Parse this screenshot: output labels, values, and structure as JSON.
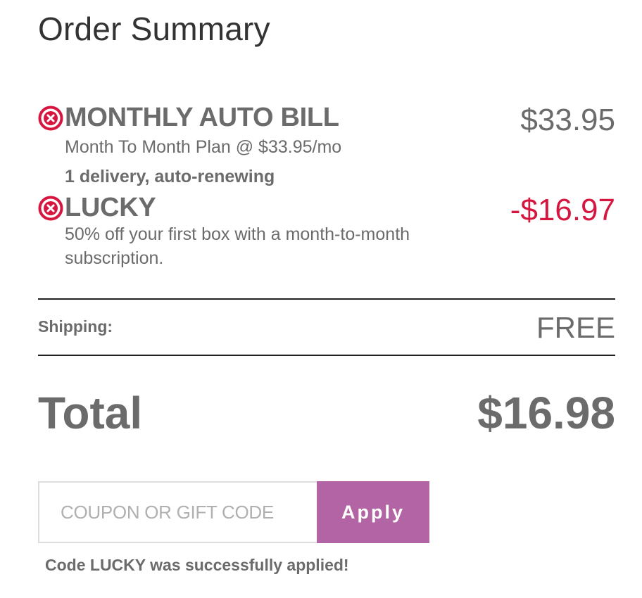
{
  "summary": {
    "title": "Order Summary"
  },
  "items": [
    {
      "name": "MONTHLY AUTO BILL",
      "price": "$33.95",
      "detail": "Month To Month Plan @ $33.95/mo",
      "note": "1 delivery, auto-renewing",
      "remove_icon": "remove-circle-x-icon"
    },
    {
      "name": "LUCKY",
      "price": "-$16.97",
      "detail_line1": "50% off your first box with a month-to-month",
      "detail_line2": "subscription.",
      "remove_icon": "remove-circle-x-icon"
    }
  ],
  "shipping": {
    "label": "Shipping:",
    "value": "FREE"
  },
  "total": {
    "label": "Total",
    "value": "$16.98"
  },
  "coupon": {
    "placeholder": "COUPON OR GIFT CODE",
    "value": "",
    "apply_label": "Apply",
    "message": "Code LUCKY was successfully applied!"
  },
  "colors": {
    "accent": "#b264a4",
    "discount": "#d6163f",
    "text": "#6b6b6b",
    "heading": "#333333"
  }
}
